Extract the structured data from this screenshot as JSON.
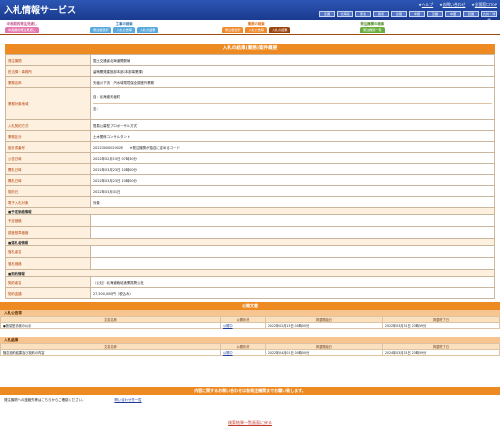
{
  "header": {
    "title": "入札情報サービス",
    "links": [
      "ヘルプ",
      "お問い合わせ",
      "全国窓口T0P"
    ],
    "regions": [
      "全国",
      "北海道",
      "東北",
      "関東",
      "北陸",
      "中部",
      "近畿",
      "中国",
      "四国",
      "九州・沖縄"
    ]
  },
  "nav": {
    "groups": [
      {
        "label": "工事の検索",
        "tabs": [
          {
            "label": "発注者選択"
          },
          {
            "label": "入札公告等"
          },
          {
            "label": "入札の結果"
          }
        ]
      },
      {
        "label": "業務の検索",
        "tabs": [
          {
            "label": "発注者選択"
          },
          {
            "label": "入札公告等"
          },
          {
            "label": "入札の結果"
          }
        ]
      },
      {
        "label": "発注機関の検索",
        "tabs": [
          {
            "label": "発注機関一覧"
          }
        ]
      }
    ],
    "side_label": "中長期的発注見通し",
    "side_tab": "中長期的発注見通し"
  },
  "detail": {
    "title": "入札の結果(業務)案件概要",
    "rows": [
      {
        "label": "発注機関",
        "value": "国土交通省北海道開発局"
      },
      {
        "label": "担当課・事務所",
        "value": "留萌開発建設部本部(本部事業課)"
      },
      {
        "label": "業務名称",
        "value": "天塩川下流　汽水域環境保全調査外業務"
      },
      {
        "label": "業務対象地域",
        "value": "自：北海道天塩町",
        "value2": "至："
      },
      {
        "label": "入札契約方式",
        "value": "簡易公募型プロポーザル方式"
      },
      {
        "label": "業務区分",
        "value": "土木関係コンサルタント"
      },
      {
        "label": "設計書番号",
        "value": "2022300002002E",
        "note": "※発注機関が独自に定めるコード"
      },
      {
        "label": "公告日時",
        "value": "2022年02月15日 07時30分"
      },
      {
        "label": "開札日時",
        "value": "2022年03月23日 10時00分"
      },
      {
        "label": "開札日時",
        "value": "2022年03月23日 10時00分"
      },
      {
        "label": "契約日",
        "value": "2022年03月31日"
      },
      {
        "label": "電子入札対象",
        "value": "対象"
      }
    ],
    "sub1": "■予定価格情報",
    "rows2": [
      {
        "label": "予定価格",
        "value": ""
      },
      {
        "label": "調査基準価格",
        "value": ""
      }
    ],
    "sub2": "■落札者情報",
    "rows3": [
      {
        "label": "落札者名",
        "value": ""
      },
      {
        "label": "落札価格",
        "value": ""
      }
    ],
    "sub3": "■契約情報",
    "rows4": [
      {
        "label": "契約者名",
        "value": "（公社）北海道栽培漁業振興公社"
      },
      {
        "label": "契約金額",
        "value": "27,500,000円（税込み）"
      }
    ]
  },
  "public": {
    "title": "公開文書",
    "sec1": "入札公告等",
    "cols": [
      "文書名称",
      "公開状況",
      "掲載開始日",
      "掲載終了日"
    ],
    "rows1": [
      [
        "●簡易型手続の公示",
        "公開中",
        "2022年02月15日 00時00分",
        "2022年03月31日 23時59分"
      ]
    ],
    "sec2": "入札結果",
    "rows2": [
      [
        "随意契約結果及び契約の内容",
        "公開中",
        "2022年04月01日 00時00分",
        "2024年03月31日 23時59分"
      ]
    ]
  },
  "inquiry": {
    "title": "内容に関するお問い合わせは各発注機関までお願い致します。",
    "text": "発注機関への連絡先等はこちらからご確認ください。",
    "link": "問い合わせ先一覧"
  },
  "back_link": "検索結果一覧画面に戻る",
  "colors": {
    "orange": "#ee8a22",
    "navy": "#1a3a8e",
    "label_bg": "#fdf0de"
  }
}
